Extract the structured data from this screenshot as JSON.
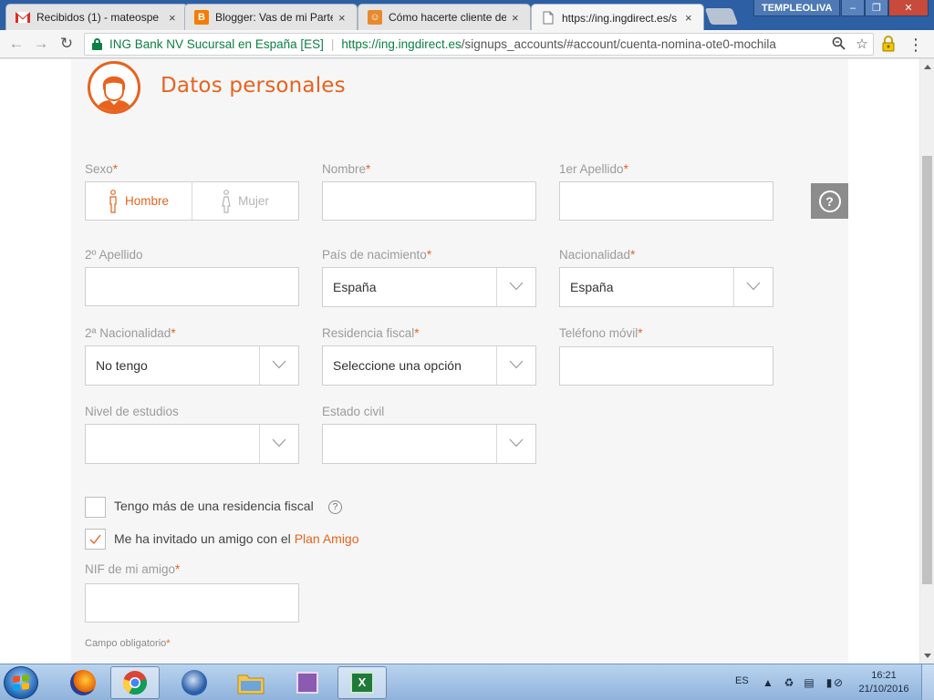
{
  "browser": {
    "tabs": [
      {
        "title": "Recibidos (1) - mateospe",
        "favicon": "gmail-icon",
        "active": false
      },
      {
        "title": "Blogger: Vas de mi Parte",
        "favicon": "blogger-icon",
        "active": false
      },
      {
        "title": "Cómo hacerte cliente de",
        "favicon": "web-icon",
        "active": false
      },
      {
        "title": "https://ing.ingdirect.es/s",
        "favicon": "page-icon",
        "active": true
      }
    ],
    "tab_close": "×",
    "user_name": "TEMPLEOLIVA",
    "address": {
      "ev_name": "ING Bank NV Sucursal en España [ES]",
      "url_host": "https://ing.ingdirect.es",
      "url_path": "/signups_accounts/#account/cuenta-nomina-ote0-mochila"
    }
  },
  "form": {
    "section_title": "Datos personales",
    "required_mark": "*",
    "fields": {
      "sexo": {
        "label": "Sexo"
      },
      "nombre": {
        "label": "Nombre"
      },
      "apellido1": {
        "label": "1er Apellido"
      },
      "apellido2": {
        "label": "2º Apellido"
      },
      "pais_nacimiento": {
        "label": "País de nacimiento",
        "value": "España"
      },
      "nacionalidad": {
        "label": "Nacionalidad",
        "value": "España"
      },
      "nacionalidad2": {
        "label": "2ª Nacionalidad",
        "value": "No tengo"
      },
      "residencia_fiscal": {
        "label": "Residencia fiscal",
        "value": "Seleccione una opción"
      },
      "telefono": {
        "label": "Teléfono móvil"
      },
      "estudios": {
        "label": "Nivel de estudios",
        "value": ""
      },
      "estado_civil": {
        "label": "Estado civil",
        "value": ""
      },
      "nif_amigo": {
        "label": "NIF de mi amigo"
      }
    },
    "gender_options": {
      "male": "Hombre",
      "female": "Mujer"
    },
    "gender_selected": "male",
    "checkboxes": {
      "multi_residence": {
        "label": "Tengo más de una residencia fiscal",
        "checked": false
      },
      "friend_invite": {
        "label_prefix": "Me ha invitado un amigo con el ",
        "link": "Plan Amigo",
        "checked": true
      }
    },
    "help_label": "?",
    "footnote": "Campo obligatorio"
  },
  "taskbar": {
    "language": "ES",
    "time": "16:21",
    "date": "21/10/2016"
  },
  "colors": {
    "accent": "#e7631f",
    "label": "#9b9b9b",
    "secure": "#0b8043"
  }
}
